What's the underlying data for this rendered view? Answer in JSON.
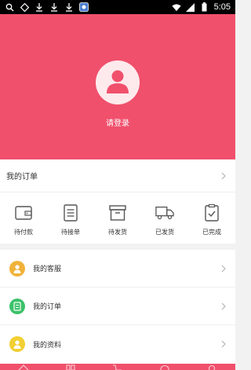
{
  "status_bar": {
    "time": "5:05",
    "left_icons": [
      "search-icon",
      "settings-icon",
      "download-icon",
      "download-icon",
      "download-icon",
      "app-notification-icon"
    ],
    "right_icons": [
      "wifi-icon",
      "signal-icon",
      "battery-icon"
    ]
  },
  "profile": {
    "login_label": "请登录",
    "background": "#f0506c"
  },
  "orders": {
    "title": "我的订单",
    "statuses": [
      {
        "label": "待付款",
        "icon": "wallet-icon"
      },
      {
        "label": "待接单",
        "icon": "list-icon"
      },
      {
        "label": "待发货",
        "icon": "package-icon"
      },
      {
        "label": "已发货",
        "icon": "truck-icon"
      },
      {
        "label": "已完成",
        "icon": "clipboard-check-icon"
      }
    ]
  },
  "menu": [
    {
      "label": "我的客服",
      "icon": "customer-service-icon",
      "color": "#f0b23a"
    },
    {
      "label": "我的订单",
      "icon": "order-doc-icon",
      "color": "#3cc26a"
    },
    {
      "label": "我的资料",
      "icon": "profile-icon",
      "color": "#f2cf32"
    }
  ],
  "tabbar": {
    "icons": [
      "home-icon",
      "grid-icon",
      "cart-icon",
      "chat-icon",
      "user-icon"
    ],
    "accent": "#f0506c"
  }
}
